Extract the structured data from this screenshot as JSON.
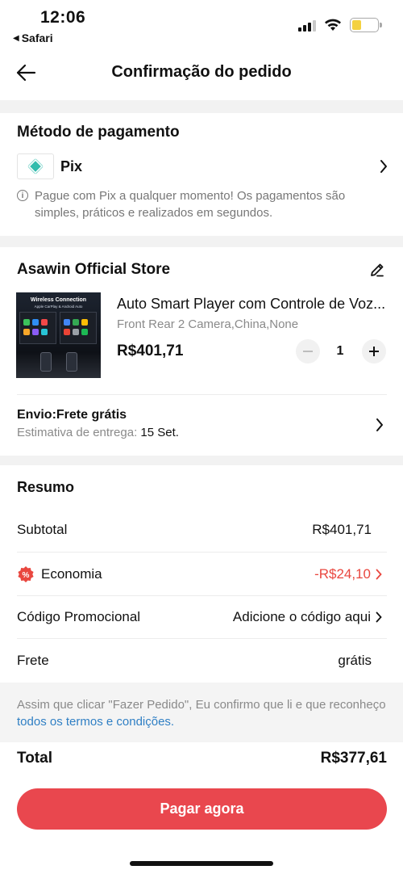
{
  "status_bar": {
    "time": "12:06",
    "back_app": "Safari"
  },
  "header": {
    "title": "Confirmação do pedido"
  },
  "payment": {
    "section_title": "Método de pagamento",
    "method": "Pix",
    "info": "Pague com Pix a qualquer momento! Os pagamentos são simples, práticos e realizados em segundos."
  },
  "store": {
    "name": "Asawin Official Store",
    "product": {
      "image_title": "Wireless Connection",
      "image_subtitle": "Apple CarPlay & Android Auto",
      "title": "Auto Smart Player com Controle de Voz...",
      "variant": "Front Rear 2 Camera,China,None",
      "price": "R$401,71",
      "quantity": "1"
    },
    "shipping": {
      "title": "Envio:Frete grátis",
      "estimate_label": "Estimativa de entrega: ",
      "estimate_date": "15 Set."
    }
  },
  "summary": {
    "title": "Resumo",
    "rows": [
      {
        "label": "Subtotal",
        "value": "R$401,71"
      },
      {
        "label": "Economia",
        "value": "-R$24,10"
      },
      {
        "label": "Código Promocional",
        "value": "Adicione o código aqui"
      },
      {
        "label": "Frete",
        "value": "grátis"
      }
    ]
  },
  "terms": {
    "text": "Assim que clicar \"Fazer Pedido\", Eu confirmo que li e que reconheço ",
    "link": "todos os termos e condições."
  },
  "total": {
    "label": "Total",
    "value": "R$377,61"
  },
  "pay_button": "Pagar agora",
  "colors": {
    "accent": "#e9474e",
    "link": "#2f7fc4",
    "discount": "#e9473f",
    "pix": "#32bcad"
  }
}
